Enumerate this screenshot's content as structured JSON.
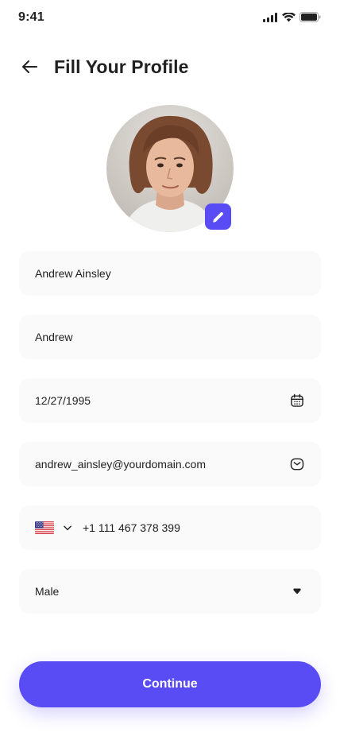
{
  "status_bar": {
    "time": "9:41"
  },
  "header": {
    "title": "Fill Your Profile"
  },
  "form": {
    "full_name": "Andrew Ainsley",
    "nickname": "Andrew",
    "date_of_birth": "12/27/1995",
    "email": "andrew_ainsley@yourdomain.com",
    "phone": "+1 111 467 378 399",
    "gender": "Male"
  },
  "continue_label": "Continue",
  "colors": {
    "accent": "#5a4cf5",
    "field_bg": "#fafafa",
    "text": "#212121"
  },
  "icons": {
    "back": "arrow-left-icon",
    "edit": "pencil-icon",
    "calendar": "calendar-icon",
    "email": "envelope-icon",
    "flag": "us-flag-icon",
    "dropdown": "chevron-down-icon",
    "gender_dropdown": "caret-down-icon"
  }
}
